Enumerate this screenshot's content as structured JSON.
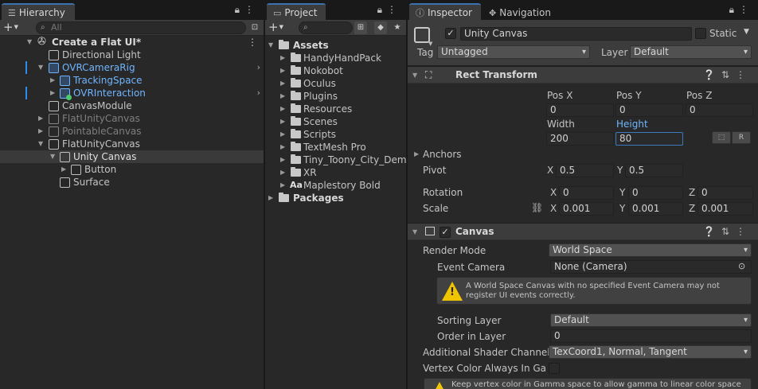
{
  "hierarchy": {
    "tab_label": "Hierarchy",
    "search_placeholder": "All",
    "rows": [
      {
        "label": "Create a Flat UI*",
        "style": "scene"
      },
      {
        "label": "Directional Light",
        "style": "normal"
      },
      {
        "label": "OVRCameraRig",
        "style": "prefab"
      },
      {
        "label": "TrackingSpace",
        "style": "prefab"
      },
      {
        "label": "OVRInteraction",
        "style": "prefab"
      },
      {
        "label": "CanvasModule",
        "style": "normal"
      },
      {
        "label": "FlatUnityCanvas",
        "style": "disabled"
      },
      {
        "label": "PointableCanvas",
        "style": "disabled"
      },
      {
        "label": "FlatUnityCanvas",
        "style": "normal"
      },
      {
        "label": "Unity Canvas",
        "style": "selected"
      },
      {
        "label": "Button",
        "style": "normal"
      },
      {
        "label": "Surface",
        "style": "normal"
      }
    ]
  },
  "project": {
    "tab_label": "Project",
    "root": "Assets",
    "folders": [
      "HandyHandPack",
      "Nokobot",
      "Oculus",
      "Plugins",
      "Resources",
      "Scenes",
      "Scripts",
      "TextMesh Pro",
      "Tiny_Toony_City_Demo",
      "XR"
    ],
    "font_asset": "Maplestory Bold",
    "font_asset_icon": "Aa",
    "packages": "Packages"
  },
  "inspector": {
    "tab_inspector": "Inspector",
    "tab_navigation": "Navigation",
    "object_name": "Unity Canvas",
    "static_label": "Static",
    "tag_label": "Tag",
    "tag_value": "Untagged",
    "layer_label": "Layer",
    "layer_value": "Default",
    "rect_transform": {
      "title": "Rect Transform",
      "pos_x_label": "Pos X",
      "pos_x": "0",
      "pos_y_label": "Pos Y",
      "pos_y": "0",
      "pos_z_label": "Pos Z",
      "pos_z": "0",
      "width_label": "Width",
      "width": "200",
      "height_label": "Height",
      "height": "80",
      "r_button": "R",
      "anchors_label": "Anchors",
      "pivot_label": "Pivot",
      "pivot_x": "0.5",
      "pivot_y": "0.5",
      "rotation_label": "Rotation",
      "rot_x": "0",
      "rot_y": "0",
      "rot_z": "0",
      "scale_label": "Scale",
      "scale_x": "0.001",
      "scale_y": "0.001",
      "scale_z": "0.001",
      "x": "X",
      "y": "Y",
      "z": "Z"
    },
    "canvas": {
      "title": "Canvas",
      "render_mode_label": "Render Mode",
      "render_mode": "World Space",
      "event_camera_label": "Event Camera",
      "event_camera": "None (Camera)",
      "warning": "A World Space Canvas with no specified Event Camera may not register UI events correctly.",
      "sorting_layer_label": "Sorting Layer",
      "sorting_layer": "Default",
      "order_in_layer_label": "Order in Layer",
      "order_in_layer": "0",
      "shader_channels_label": "Additional Shader Channels",
      "shader_channels": "TexCoord1, Normal, Tangent",
      "vertex_color_label": "Vertex Color Always In Gam",
      "gamma_warning": "Keep vertex color in Gamma space to allow gamma to linear color space"
    }
  },
  "colors": {
    "selection_blue": "#3a72b0",
    "prefab_blue": "#70b5ff",
    "warning_yellow": "#f0c400",
    "panel_bg": "#282828",
    "header_bg": "#3c3c3c"
  }
}
